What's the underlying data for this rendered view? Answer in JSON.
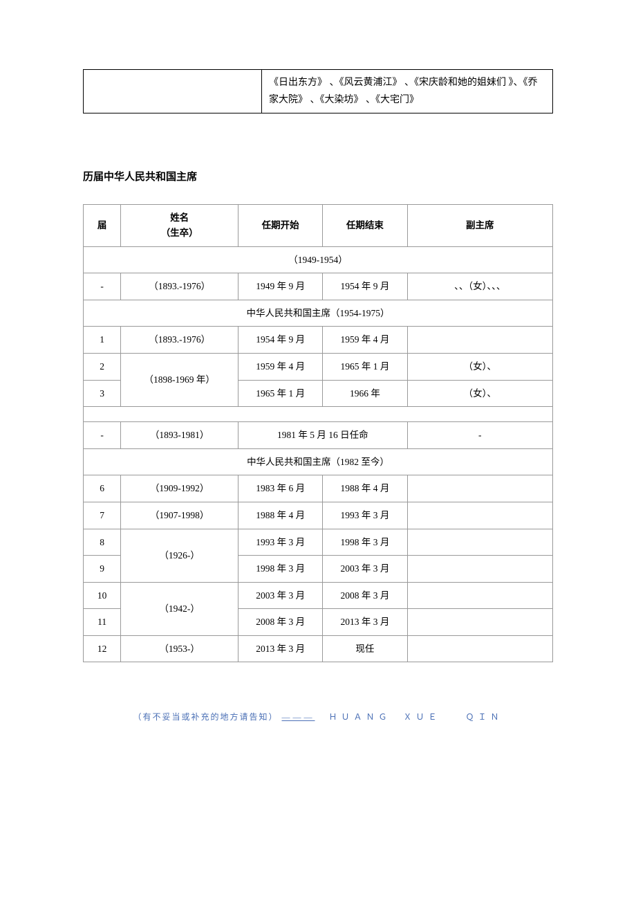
{
  "top_box": {
    "text": "《日出东方》 、《风云黄浦江》 、《宋庆龄和她的姐妹们 》、《乔家大院》 、《大染坊》 、《大宅门》"
  },
  "section_title": "历届中华人民共和国主席",
  "headers": {
    "term": "届",
    "name_top": "姓名",
    "name_sub": "（生卒）",
    "start": "任期开始",
    "end": "任期结束",
    "vice": "副主席"
  },
  "group1": {
    "label": "（1949-1954）",
    "row": {
      "term": "-",
      "name": "（1893.-1976）",
      "start": "1949 年 9 月",
      "end": "1954 年 9 月",
      "vice": "、、（女）、、、"
    }
  },
  "group2": {
    "label": "中华人民共和国主席（1954-1975）",
    "row1": {
      "term": "1",
      "name": "（1893.-1976）",
      "start": "1954 年 9 月",
      "end": "1959 年 4 月",
      "vice": ""
    },
    "row2": {
      "term": "2",
      "start": "1959 年 4 月",
      "end": "1965 年 1 月",
      "vice": "（女）、"
    },
    "name_span": "（1898-1969 年）",
    "row3": {
      "term": "3",
      "start": "1965 年 1 月",
      "end": "1966 年",
      "vice": "（女）、"
    }
  },
  "group3": {
    "row": {
      "term": "-",
      "name": "（1893-1981）",
      "mid": "1981 年 5 月 16 日任命",
      "vice": "-"
    }
  },
  "group4": {
    "label": "中华人民共和国主席（1982 至今）",
    "row6": {
      "term": "6",
      "name": "（1909-1992）",
      "start": "1983 年 6 月",
      "end": "1988 年 4 月",
      "vice": ""
    },
    "row7": {
      "term": "7",
      "name": "（1907-1998）",
      "start": "1988 年 4 月",
      "end": "1993 年 3 月",
      "vice": ""
    },
    "row8": {
      "term": "8",
      "start": "1993 年 3 月",
      "end": "1998 年 3 月",
      "vice": ""
    },
    "name_span_89": "（1926-）",
    "row9": {
      "term": "9",
      "start": "1998 年 3 月",
      "end": "2003 年 3 月",
      "vice": ""
    },
    "row10": {
      "term": "10",
      "start": "2003 年 3 月",
      "end": "2008 年 3 月",
      "vice": ""
    },
    "name_span_1011": "（1942-）",
    "row11": {
      "term": "11",
      "start": "2008 年 3 月",
      "end": "2013 年 3 月",
      "vice": ""
    },
    "row12": {
      "term": "12",
      "name": "（1953-）",
      "start": "2013 年 3 月",
      "end": "现任",
      "vice": ""
    }
  },
  "footer": {
    "note": "（有不妥当或补充的地方请告知）",
    "line": "———",
    "signature": "ＨＵＡＮＧ　ＸＵＥ　　ＱＩＮ"
  }
}
